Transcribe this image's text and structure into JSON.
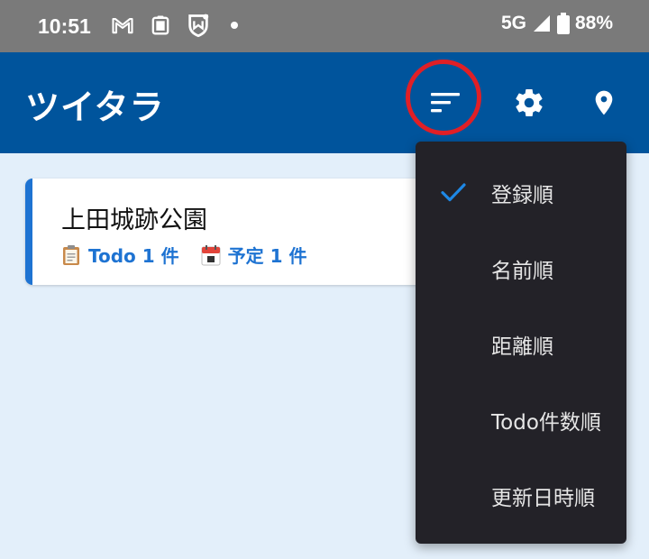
{
  "status_bar": {
    "time": "10:51",
    "icons": [
      "gmail-icon",
      "clipboard-app-icon",
      "shield-app-icon"
    ],
    "network": "5G",
    "battery": "88%"
  },
  "app_bar": {
    "title": "ツイタラ",
    "actions": [
      "sort-icon",
      "gear-icon",
      "location-pin-icon"
    ]
  },
  "card": {
    "title": "上田城跡公園",
    "todo_label": "Todo 1 件",
    "schedule_label": "予定 1 件",
    "accent_color": "#1e73d2"
  },
  "sort_menu": {
    "items": [
      {
        "label": "登録順",
        "checked": true
      },
      {
        "label": "名前順",
        "checked": false
      },
      {
        "label": "距離順",
        "checked": false
      },
      {
        "label": "Todo件数順",
        "checked": false
      },
      {
        "label": "更新日時順",
        "checked": false
      }
    ]
  },
  "colors": {
    "app_bar": "#00549c",
    "background": "#e3effa",
    "menu": "#232228",
    "highlight": "#e01f26"
  }
}
